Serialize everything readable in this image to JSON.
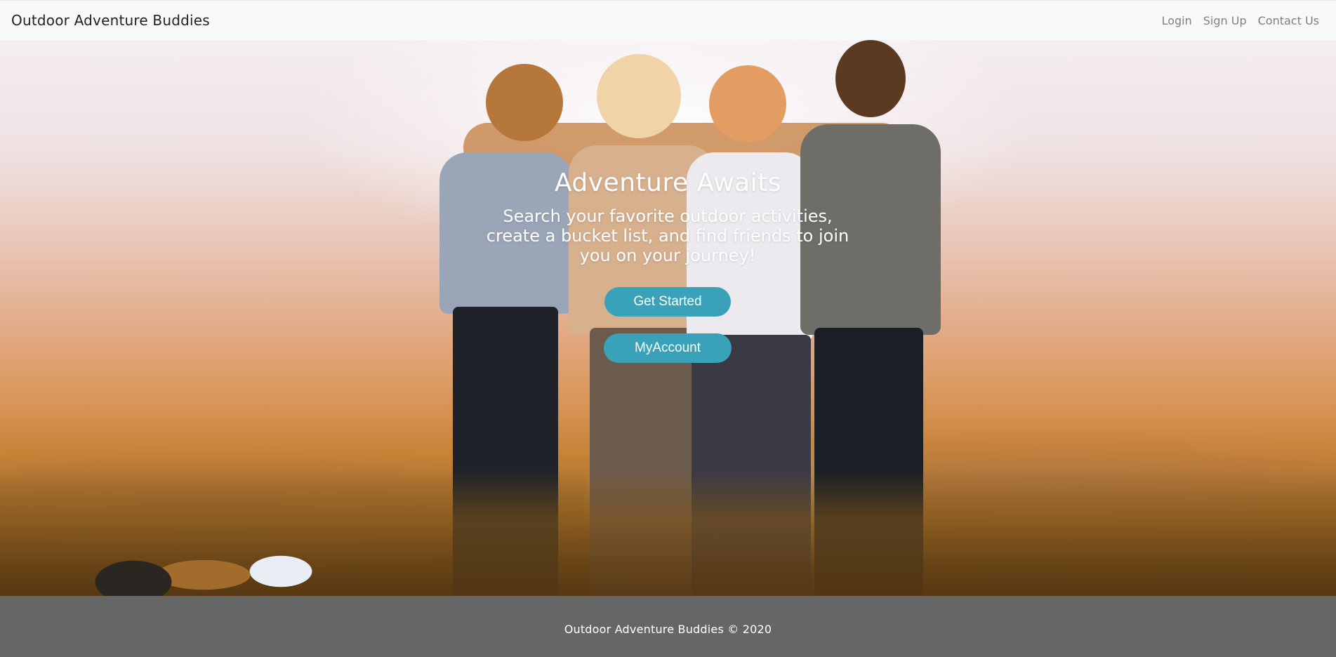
{
  "navbar": {
    "brand": "Outdoor Adventure Buddies",
    "links": [
      {
        "label": "Login"
      },
      {
        "label": "Sign Up"
      },
      {
        "label": "Contact Us"
      }
    ]
  },
  "hero": {
    "title": "Adventure Awaits",
    "subtitle": "Search your favorite outdoor activities, create a bucket list, and find friends to join you on your journey!",
    "buttons": {
      "get_started": "Get Started",
      "my_account": "MyAccount"
    }
  },
  "footer": {
    "text": "Outdoor Adventure Buddies © 2020"
  },
  "colors": {
    "navbar_bg": "#f8f9fa",
    "button_bg": "#39a2b8",
    "footer_bg": "#666666"
  }
}
